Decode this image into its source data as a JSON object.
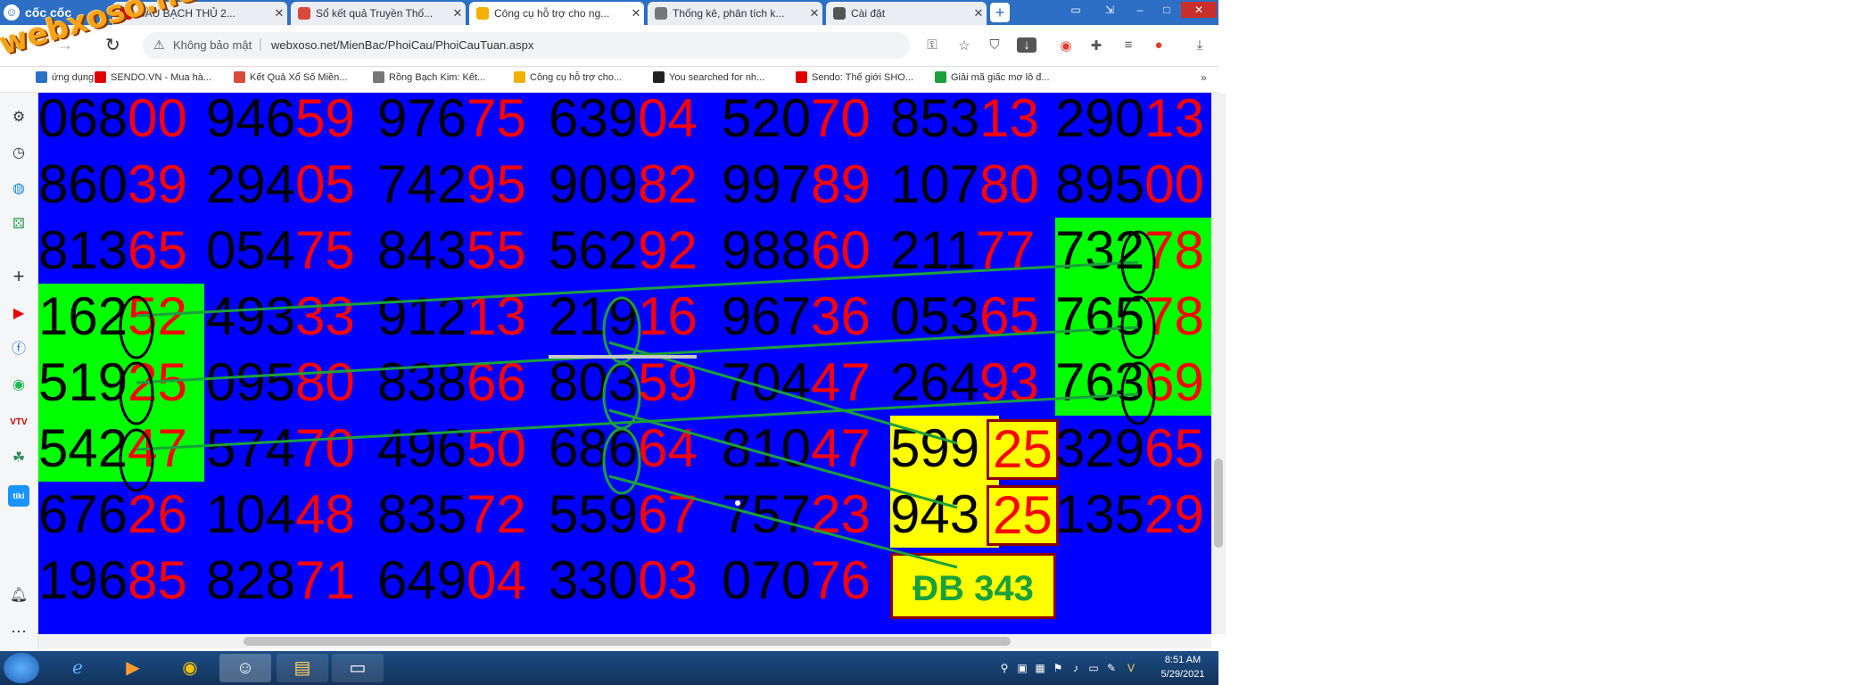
{
  "browser": {
    "brand": "cốc cốc",
    "tabs": [
      {
        "label": "CẦU BẠCH THỦ 2...",
        "active": false,
        "fav_color": "#e00000"
      },
      {
        "label": "Sổ kết quả Truyền Thố...",
        "active": false,
        "fav_color": "#d94a3a"
      },
      {
        "label": "Công cụ hỗ trợ cho ng...",
        "active": true,
        "fav_color": "#f3b000"
      },
      {
        "label": "Thống kê, phân tích k...",
        "active": false,
        "fav_color": "#777777"
      },
      {
        "label": "Cài đặt",
        "active": false,
        "fav_color": "#555555"
      }
    ],
    "security_text": "Không bảo mật",
    "url": "webxoso.net/MienBac/PhoiCau/PhoiCauTuan.aspx",
    "bookmarks": [
      "ứng dụng",
      "SENDO.VN - Mua hà...",
      "Kết Quả Xổ Số Miền...",
      "Rồng Bạch Kim: Kết...",
      "Công cụ hỗ trợ cho...",
      "You searched for nh...",
      "Sendo: Thế giới SHO...",
      "Giải mã giấc mơ lô đ..."
    ],
    "watermark": "webxoso.net"
  },
  "grid": {
    "rows": [
      [
        [
          "068",
          "00"
        ],
        [
          "946",
          "59"
        ],
        [
          "976",
          "75"
        ],
        [
          "639",
          "04"
        ],
        [
          "520",
          "70"
        ],
        [
          "853",
          "13"
        ],
        [
          "290",
          "13"
        ]
      ],
      [
        [
          "860",
          "39"
        ],
        [
          "294",
          "05"
        ],
        [
          "742",
          "95"
        ],
        [
          "909",
          "82"
        ],
        [
          "997",
          "89"
        ],
        [
          "107",
          "80"
        ],
        [
          "895",
          "00"
        ]
      ],
      [
        [
          "813",
          "65"
        ],
        [
          "054",
          "75"
        ],
        [
          "843",
          "55"
        ],
        [
          "562",
          "92"
        ],
        [
          "988",
          "60"
        ],
        [
          "211",
          "77"
        ],
        [
          "732",
          "78"
        ]
      ],
      [
        [
          "162",
          "52"
        ],
        [
          "493",
          "33"
        ],
        [
          "912",
          "13"
        ],
        [
          "219",
          "16"
        ],
        [
          "967",
          "36"
        ],
        [
          "053",
          "65"
        ],
        [
          "765",
          "78"
        ]
      ],
      [
        [
          "519",
          "25"
        ],
        [
          "095",
          "80"
        ],
        [
          "838",
          "66"
        ],
        [
          "803",
          "59"
        ],
        [
          "704",
          "47"
        ],
        [
          "264",
          "93"
        ],
        [
          "763",
          "69"
        ]
      ],
      [
        [
          "542",
          "47"
        ],
        [
          "574",
          "70"
        ],
        [
          "496",
          "50"
        ],
        [
          "686",
          "64"
        ],
        [
          "810",
          "47"
        ],
        [
          "599",
          "25"
        ],
        [
          "329",
          "65"
        ]
      ],
      [
        [
          "676",
          "26"
        ],
        [
          "104",
          "48"
        ],
        [
          "835",
          "72"
        ],
        [
          "559",
          "67"
        ],
        [
          "757",
          "23"
        ],
        [
          "943",
          "25"
        ],
        [
          "135",
          "29"
        ]
      ],
      [
        [
          "196",
          "85"
        ],
        [
          "828",
          "71"
        ],
        [
          "649",
          "04"
        ],
        [
          "330",
          "03"
        ],
        [
          "070",
          "76"
        ],
        null,
        null
      ]
    ],
    "db_label": "ĐB 343",
    "colors": {
      "background": "#0000ff",
      "prefix": "#000000",
      "suffix": "#ff0000",
      "green": "#00ff00",
      "yellow": "#ffff00",
      "line": "#1aa03c"
    }
  },
  "taskbar": {
    "time": "8:51 AM",
    "date": "5/29/2021"
  }
}
